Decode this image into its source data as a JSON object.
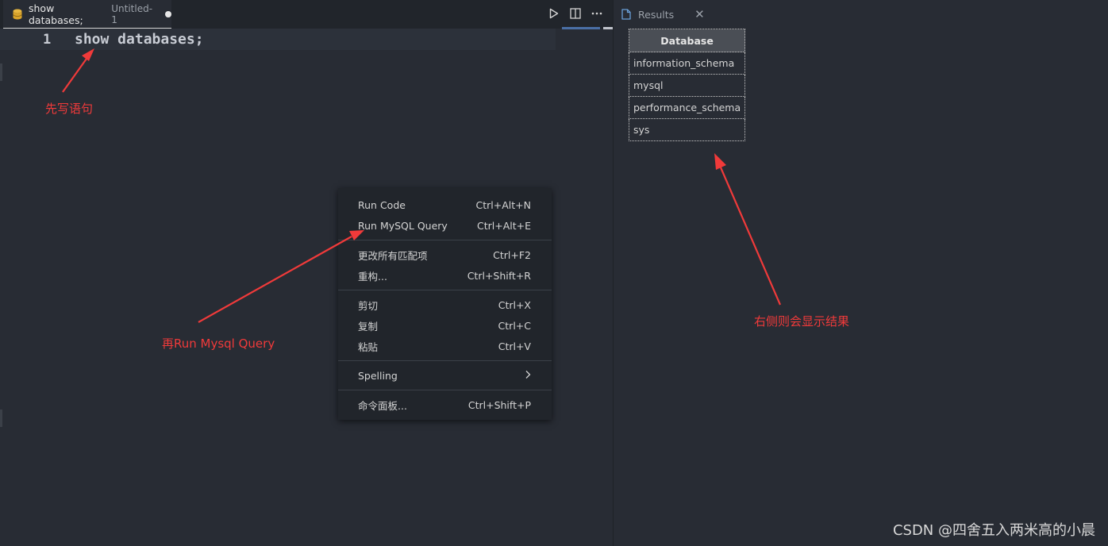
{
  "editor": {
    "tab": {
      "title": "show databases;",
      "description": "Untitled-1",
      "icon": "database-icon",
      "dirty": true
    },
    "actions": {
      "run_icon": "play-icon",
      "split_icon": "split-editor-icon",
      "more_icon": "more-actions-icon"
    },
    "lines": [
      {
        "number": "1",
        "text": "show databases;"
      }
    ]
  },
  "results": {
    "tab_label": "Results",
    "tab_icon": "file-icon",
    "close_icon": "close-icon",
    "columns": [
      "Database"
    ],
    "rows": [
      [
        "information_schema"
      ],
      [
        "mysql"
      ],
      [
        "performance_schema"
      ],
      [
        "sys"
      ]
    ]
  },
  "context_menu": {
    "groups": [
      [
        {
          "label": "Run Code",
          "shortcut": "Ctrl+Alt+N"
        },
        {
          "label": "Run MySQL Query",
          "shortcut": "Ctrl+Alt+E"
        }
      ],
      [
        {
          "label": "更改所有匹配项",
          "shortcut": "Ctrl+F2"
        },
        {
          "label": "重构...",
          "shortcut": "Ctrl+Shift+R"
        }
      ],
      [
        {
          "label": "剪切",
          "shortcut": "Ctrl+X"
        },
        {
          "label": "复制",
          "shortcut": "Ctrl+C"
        },
        {
          "label": "粘贴",
          "shortcut": "Ctrl+V"
        }
      ],
      [
        {
          "label": "Spelling",
          "submenu": true
        }
      ],
      [
        {
          "label": "命令面板...",
          "shortcut": "Ctrl+Shift+P"
        }
      ]
    ]
  },
  "annotations": {
    "first": "先写语句",
    "second": "再Run Mysql Query",
    "third": "右侧则会显示结果",
    "color": "#f03a3a"
  },
  "watermark": "CSDN @四舍五入两米高的小晨",
  "colors": {
    "background": "#282c34",
    "tab_bar": "#21252b",
    "menu_background": "#21252b",
    "accent": "#4a6fa5"
  }
}
